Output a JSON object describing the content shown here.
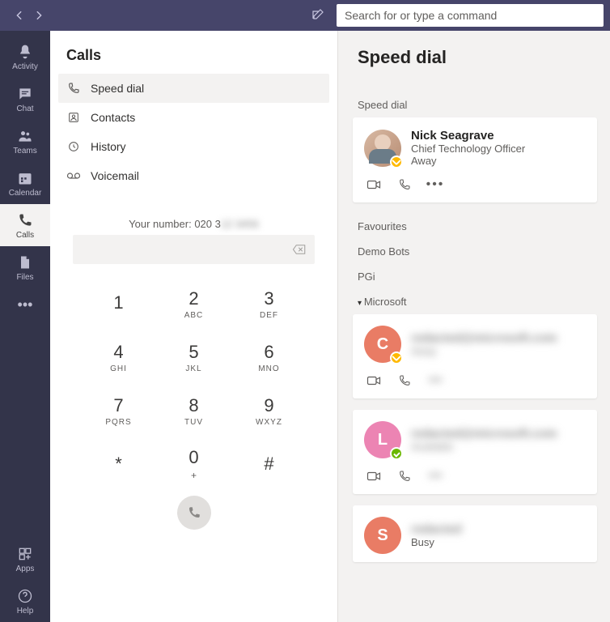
{
  "search": {
    "placeholder": "Search for or type a command"
  },
  "rail": {
    "items": [
      {
        "id": "activity",
        "label": "Activity"
      },
      {
        "id": "chat",
        "label": "Chat"
      },
      {
        "id": "teams",
        "label": "Teams"
      },
      {
        "id": "calendar",
        "label": "Calendar"
      },
      {
        "id": "calls",
        "label": "Calls"
      },
      {
        "id": "files",
        "label": "Files"
      }
    ],
    "bottom": [
      {
        "id": "apps",
        "label": "Apps"
      },
      {
        "id": "help",
        "label": "Help"
      }
    ]
  },
  "calls_panel": {
    "title": "Calls",
    "nav": {
      "speed_dial": "Speed dial",
      "contacts": "Contacts",
      "history": "History",
      "voicemail": "Voicemail"
    },
    "your_number_label": "Your number: 020 3",
    "dial_input_value": "",
    "dialpad": [
      {
        "num": "1",
        "letters": ""
      },
      {
        "num": "2",
        "letters": "ABC"
      },
      {
        "num": "3",
        "letters": "DEF"
      },
      {
        "num": "4",
        "letters": "GHI"
      },
      {
        "num": "5",
        "letters": "JKL"
      },
      {
        "num": "6",
        "letters": "MNO"
      },
      {
        "num": "7",
        "letters": "PQRS"
      },
      {
        "num": "8",
        "letters": "TUV"
      },
      {
        "num": "9",
        "letters": "WXYZ"
      },
      {
        "num": "*",
        "letters": ""
      },
      {
        "num": "0",
        "letters": "+"
      },
      {
        "num": "#",
        "letters": ""
      }
    ]
  },
  "detail": {
    "title": "Speed dial",
    "groups": {
      "speed_dial": "Speed dial",
      "favourites": "Favourites",
      "demo_bots": "Demo Bots",
      "pgi": "PGi",
      "microsoft": "Microsoft"
    },
    "contacts": {
      "nick": {
        "name": "Nick Seagrave",
        "title": "Chief Technology Officer",
        "status": "Away",
        "presence": "away",
        "avatar_color": "photo",
        "initial": ""
      },
      "c": {
        "name": "redacted@microsoft.com",
        "title": "",
        "status": "Away",
        "presence": "away",
        "avatar_color": "#e97c65",
        "initial": "C"
      },
      "l": {
        "name": "redacted@microsoft.com",
        "title": "Available",
        "status": "",
        "presence": "available",
        "avatar_color": "#ec84b3",
        "initial": "L"
      },
      "s": {
        "name": "",
        "title": "",
        "status": "Busy",
        "presence": "busy",
        "avatar_color": "#e97c65",
        "initial": "S"
      }
    },
    "action_hint": "call"
  }
}
